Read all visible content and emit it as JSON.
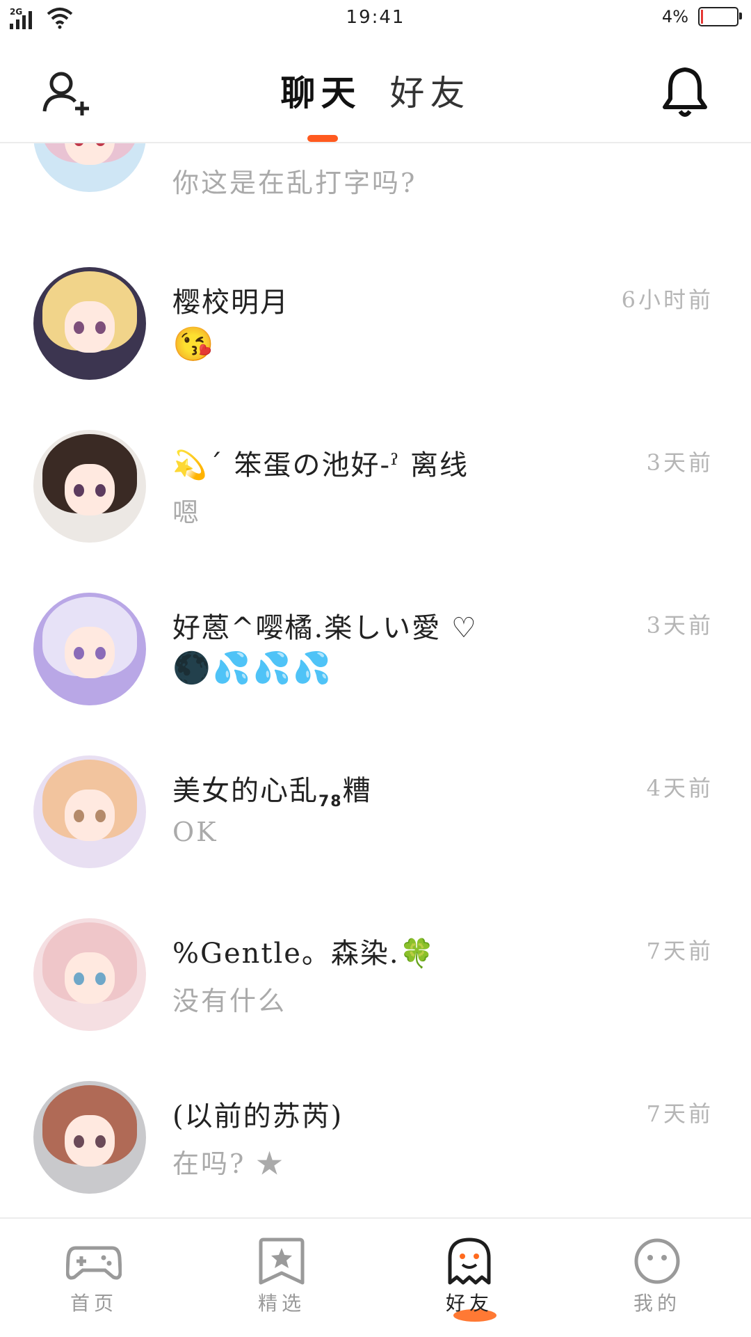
{
  "status_bar": {
    "network": "2G",
    "time": "19:41",
    "battery": "4%"
  },
  "header": {
    "tabs": [
      {
        "label": "聊天",
        "active": true
      },
      {
        "label": "好友",
        "active": false
      }
    ]
  },
  "chats": [
    {
      "name": "",
      "message": "你这是在乱打字吗?",
      "time": ""
    },
    {
      "name": "樱校明月",
      "message": "😘",
      "time": "6小时前"
    },
    {
      "name": "💫ˊ 笨蛋の池好-ˀ 离线",
      "message": "嗯",
      "time": "3天前"
    },
    {
      "name": "好蒽^嘤橘.楽しい愛 ♡",
      "message": "🌑💦💦💦",
      "time": "3天前"
    },
    {
      "name": "美女的心乱",
      "name_sub": "78",
      "name_suffix": "糟",
      "message": "OK",
      "time": "4天前"
    },
    {
      "name": "%Gentle。森染.🍀",
      "message": "没有什么",
      "time": "7天前"
    },
    {
      "name": "(以前的苏芮)",
      "message": "在吗? ★",
      "time": "7天前"
    }
  ],
  "bottom_nav": [
    {
      "label": "首页",
      "icon": "gamepad-icon",
      "active": false
    },
    {
      "label": "精选",
      "icon": "star-bookmark-icon",
      "active": false
    },
    {
      "label": "好友",
      "icon": "ghost-icon",
      "active": true
    },
    {
      "label": "我的",
      "icon": "face-icon",
      "active": false
    }
  ],
  "colors": {
    "accent": "#ff5a1f",
    "muted_text": "#aaaaaa",
    "time_text": "#b5b5b5"
  }
}
